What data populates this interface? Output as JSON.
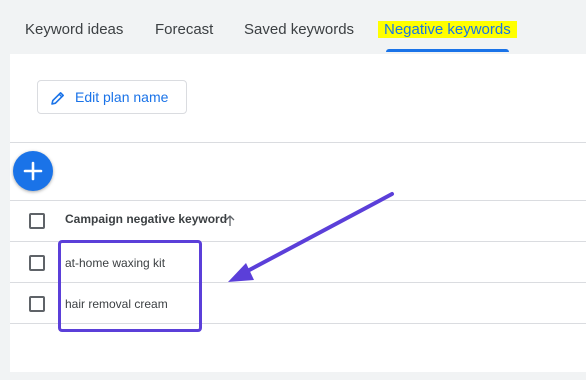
{
  "tabs": [
    {
      "label": "Keyword ideas"
    },
    {
      "label": "Forecast"
    },
    {
      "label": "Saved keywords"
    },
    {
      "label": "Negative keywords",
      "active": true
    }
  ],
  "toolbar": {
    "edit_label": "Edit plan name",
    "add_icon": "plus-icon",
    "edit_icon": "pencil-icon"
  },
  "table": {
    "column_header": "Campaign negative keyword",
    "sort_icon": "arrow-up-icon",
    "rows": [
      {
        "keyword": "at-home waxing kit"
      },
      {
        "keyword": "hair removal cream"
      }
    ]
  },
  "colors": {
    "accent": "#1a73e8",
    "tab_highlight": "#ffff00",
    "annotation": "#5b3fd9"
  }
}
